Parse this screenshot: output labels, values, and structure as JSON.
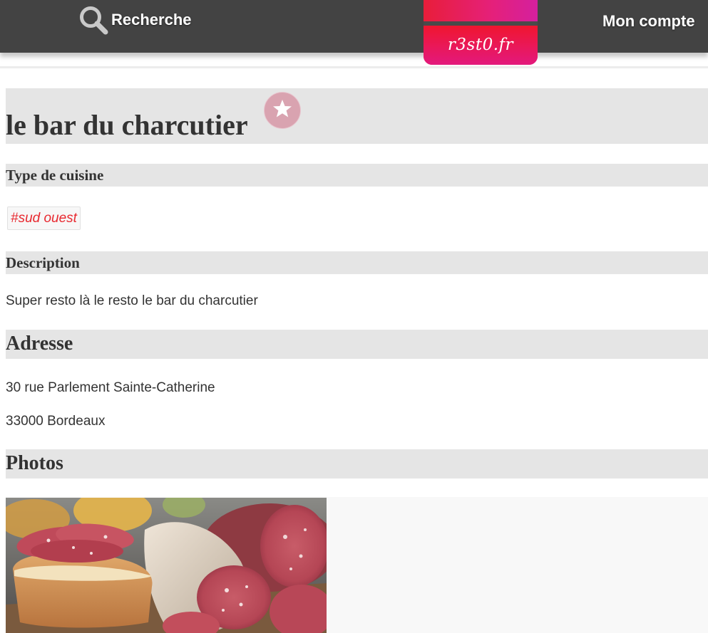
{
  "header": {
    "search_label": "Recherche",
    "account_label": "Mon compte",
    "logo_text": "r3st0.fr",
    "logo_colors": {
      "top": "#e81e3a",
      "bottom": "#e3197d",
      "band": "#4a4a4a"
    },
    "bar_color": "#434343"
  },
  "restaurant": {
    "name": "le bar du charcutier"
  },
  "sections": {
    "cuisine": {
      "title": "Type de cuisine",
      "tag": "#sud ouest"
    },
    "description": {
      "title": "Description",
      "text": "Super resto là le resto le bar du charcutier"
    },
    "address": {
      "title": "Adresse",
      "line1": "30 rue Parlement Sainte-Catherine",
      "line2": "33000 Bordeaux"
    },
    "photos": {
      "title": "Photos"
    }
  },
  "icons": {
    "search": "search-icon",
    "favorite": "star-icon"
  },
  "colors": {
    "tag_text": "#e8282f",
    "section_background": "#e5e5e5",
    "favorite_button": "#d9a3b0"
  }
}
